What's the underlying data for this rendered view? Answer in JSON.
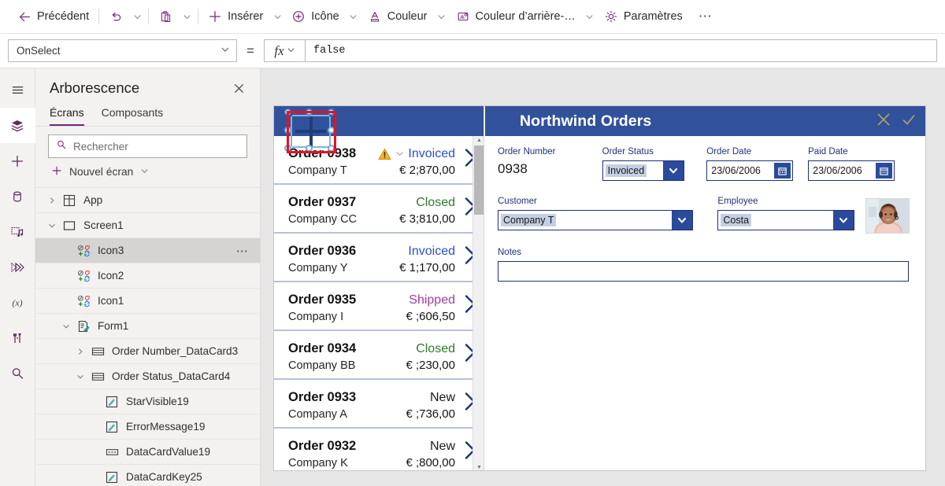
{
  "toolbar": {
    "back_label": "Précédent",
    "undo_icon": "undo-icon",
    "paste_icon": "paste-icon",
    "insert_label": "Insérer",
    "icon_label": "Icône",
    "color_label": "Couleur",
    "background_color_label": "Couleur d’arrière-…",
    "settings_label": "Paramètres",
    "overflow_label": "⋯"
  },
  "formula_bar": {
    "property": "OnSelect",
    "equals": "=",
    "fx_label": "fx",
    "formula": "false"
  },
  "rail": {
    "items": [
      {
        "name": "hamburger-icon"
      },
      {
        "name": "tree-view-icon"
      },
      {
        "name": "insert-icon"
      },
      {
        "name": "data-icon"
      },
      {
        "name": "media-icon"
      },
      {
        "name": "power-automate-icon"
      },
      {
        "name": "variables-icon"
      },
      {
        "name": "tools-icon"
      },
      {
        "name": "search-icon"
      }
    ]
  },
  "tree_panel": {
    "title": "Arborescence",
    "close_icon": "close-icon",
    "tabs": [
      {
        "label": "Écrans",
        "selected": true
      },
      {
        "label": "Composants",
        "selected": false
      }
    ],
    "search_placeholder": "Rechercher",
    "new_screen_label": "Nouvel écran",
    "nodes": [
      {
        "label": "App",
        "indent": 0,
        "twisty": "collapsed",
        "icon": "app-icon",
        "selected": false,
        "menu": false
      },
      {
        "label": "Screen1",
        "indent": 0,
        "twisty": "expanded",
        "icon": "screen-icon",
        "selected": false,
        "menu": false
      },
      {
        "label": "Icon3",
        "indent": 1,
        "twisty": "none",
        "icon": "icon-control-icon",
        "selected": true,
        "menu": true
      },
      {
        "label": "Icon2",
        "indent": 1,
        "twisty": "none",
        "icon": "icon-control-icon",
        "selected": false,
        "menu": false
      },
      {
        "label": "Icon1",
        "indent": 1,
        "twisty": "none",
        "icon": "icon-control-icon",
        "selected": false,
        "menu": false
      },
      {
        "label": "Form1",
        "indent": 1,
        "twisty": "expanded",
        "icon": "form-icon",
        "selected": false,
        "menu": false
      },
      {
        "label": "Order Number_DataCard3",
        "indent": 2,
        "twisty": "collapsed",
        "icon": "datacard-icon",
        "selected": false,
        "menu": false
      },
      {
        "label": "Order Status_DataCard4",
        "indent": 2,
        "twisty": "expanded",
        "icon": "datacard-icon",
        "selected": false,
        "menu": false
      },
      {
        "label": "StarVisible19",
        "indent": 3,
        "twisty": "none",
        "icon": "label-icon",
        "selected": false,
        "menu": false
      },
      {
        "label": "ErrorMessage19",
        "indent": 3,
        "twisty": "none",
        "icon": "label-icon",
        "selected": false,
        "menu": false
      },
      {
        "label": "DataCardValue19",
        "indent": 3,
        "twisty": "none",
        "icon": "dropdown-icon",
        "selected": false,
        "menu": false
      },
      {
        "label": "DataCardKey25",
        "indent": 3,
        "twisty": "none",
        "icon": "label-icon",
        "selected": false,
        "menu": false
      }
    ]
  },
  "app_preview": {
    "header_color": "#31529b",
    "title": "Northwind Orders",
    "header_icons": [
      {
        "name": "cancel-icon",
        "glyph": "✕"
      },
      {
        "name": "confirm-icon",
        "glyph": "✓"
      }
    ],
    "gallery": {
      "items": [
        {
          "order": "Order 0938",
          "company": "Company T",
          "status": "Invoiced",
          "status_color": "#2b4fd4",
          "amount": "€ 2;870,00",
          "warning": true
        },
        {
          "order": "Order 0937",
          "company": "Company CC",
          "status": "Closed",
          "status_color": "#2d7a2d",
          "amount": "€ 3;810,00",
          "warning": false
        },
        {
          "order": "Order 0936",
          "company": "Company Y",
          "status": "Invoiced",
          "status_color": "#2b4fd4",
          "amount": "€ 1;170,00",
          "warning": false
        },
        {
          "order": "Order 0935",
          "company": "Company I",
          "status": "Shipped",
          "status_color": "#a23ba2",
          "amount": "€ ;606,50",
          "warning": false
        },
        {
          "order": "Order 0934",
          "company": "Company BB",
          "status": "Closed",
          "status_color": "#2d7a2d",
          "amount": "€ ;230,00",
          "warning": false
        },
        {
          "order": "Order 0933",
          "company": "Company A",
          "status": "New",
          "status_color": "#1a1a1a",
          "amount": "€ ;736,00",
          "warning": false
        },
        {
          "order": "Order 0932",
          "company": "Company K",
          "status": "New",
          "status_color": "#1a1a1a",
          "amount": "€ ;800,00",
          "warning": false
        }
      ]
    },
    "form": {
      "order_number": {
        "label": "Order Number",
        "value": "0938"
      },
      "order_status": {
        "label": "Order Status",
        "value": "Invoiced"
      },
      "order_date": {
        "label": "Order Date",
        "value": "23/06/2006"
      },
      "paid_date": {
        "label": "Paid Date",
        "value": "23/06/2006"
      },
      "customer": {
        "label": "Customer",
        "value": "Company T"
      },
      "employee": {
        "label": "Employee",
        "value": "Costa"
      },
      "notes": {
        "label": "Notes",
        "value": ""
      },
      "employee_photo": "employee-photo"
    }
  }
}
